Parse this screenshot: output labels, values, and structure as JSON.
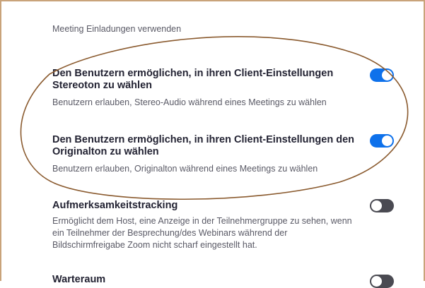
{
  "colors": {
    "toggle_on": "#0e71eb",
    "toggle_off": "#4a4a52",
    "annotation_ellipse": "#8a5a2e",
    "frame_border": "#c9a37a"
  },
  "top_text": "Meeting Einladungen verwenden",
  "settings": [
    {
      "title": "Den Benutzern ermöglichen, in ihren Client-Einstellungen Stereoton zu wählen",
      "description": "Benutzern erlauben, Stereo-Audio während eines Meetings zu wählen",
      "enabled": true
    },
    {
      "title": "Den Benutzern ermöglichen, in ihren Client-Einstellungen den Originalton zu wählen",
      "description": "Benutzern erlauben, Originalton während eines Meetings zu wählen",
      "enabled": true
    },
    {
      "title": "Aufmerksamkeitstracking",
      "description": "Ermöglicht dem Host, eine Anzeige in der Teilnehmergruppe zu sehen, wenn ein Teilnehmer der Besprechung/des Webinars während der Bildschirmfreigabe Zoom nicht scharf eingestellt hat.",
      "enabled": false
    },
    {
      "title": "Warteraum",
      "description": "",
      "enabled": false
    }
  ]
}
